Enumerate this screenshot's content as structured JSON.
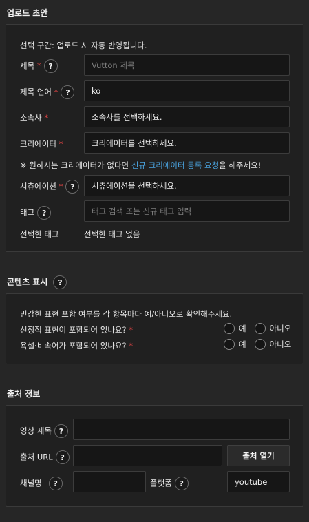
{
  "upload": {
    "title": "업로드 초안",
    "notice": "선택 구간: 업로드 시 자동 반영됩니다.",
    "title_label": "제목",
    "title_placeholder": "Vutton 제목",
    "lang_label": "제목 언어",
    "lang_value": "ko",
    "studio_label": "소속사",
    "studio_value": "소속사를 선택하세요.",
    "creator_label": "크리에이터",
    "creator_value": "크리에이터를 선택하세요.",
    "creator_note_pre": "※ 원하시는 크리에이터가 없다면",
    "creator_note_link": "신규 크리에이터 등록 요청",
    "creator_note_post": "을 해주세요!",
    "situation_label": "시츄에이션",
    "situation_value": "시츄에이션을 선택하세요.",
    "tag_label": "태그",
    "tag_placeholder": "태그 검색 또는 신규 태그 입력",
    "selected_tags_label": "선택한 태그",
    "selected_tags_value": "선택한 태그 없음"
  },
  "content": {
    "title": "콘텐츠 표시",
    "notice": "민감한 표현 포함 여부를 각 항목마다 예/아니오로 확인해주세요.",
    "q1": "선정적 표현이 포함되어 있나요?",
    "q2": "욕설·비속어가 포함되어 있나요?",
    "yes": "예",
    "no": "아니오"
  },
  "source": {
    "title": "출처 정보",
    "video_title_label": "영상 제목",
    "url_label": "출처 URL",
    "open_button": "출처 열기",
    "channel_label": "채널명",
    "platform_label": "플랫폼",
    "platform_value": "youtube"
  },
  "symbols": {
    "required": "*",
    "help": "?"
  }
}
